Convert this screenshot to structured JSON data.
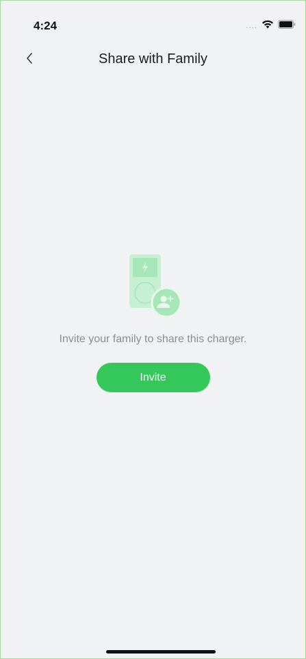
{
  "status_bar": {
    "time": "4:24",
    "signal": "....",
    "icons": [
      "wifi-icon",
      "battery-icon"
    ]
  },
  "nav": {
    "title": "Share with Family",
    "back_icon": "chevron-left-icon"
  },
  "empty_state": {
    "illustration": "charger-share-illustration",
    "message": "Invite your family to share this charger.",
    "invite_label": "Invite"
  },
  "colors": {
    "accent": "#34c759",
    "background": "#f1f2f4",
    "illustration_green": "#b8ecc5"
  }
}
